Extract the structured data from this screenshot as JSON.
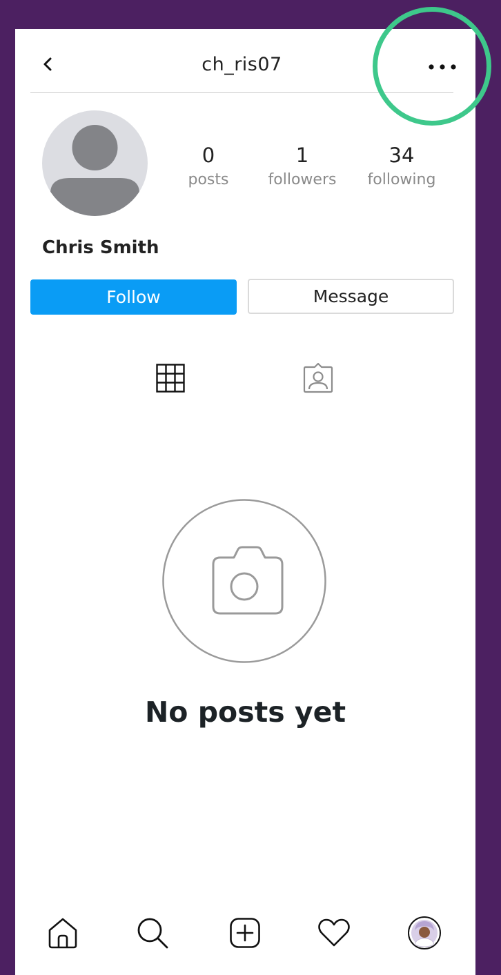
{
  "header": {
    "username": "ch_ris07"
  },
  "profile": {
    "full_name": "Chris Smith",
    "stats": [
      {
        "value": "0",
        "label": "posts"
      },
      {
        "value": "1",
        "label": "followers"
      },
      {
        "value": "34",
        "label": "following"
      }
    ]
  },
  "actions": {
    "follow_label": "Follow",
    "message_label": "Message"
  },
  "tabs": [
    {
      "icon": "grid-icon",
      "active": true
    },
    {
      "icon": "tagged-person-icon",
      "active": false
    }
  ],
  "empty_state": {
    "title": "No posts yet",
    "icon": "camera-icon"
  },
  "bottom_nav": [
    "home-icon",
    "search-icon",
    "add-post-icon",
    "heart-icon",
    "profile-avatar"
  ],
  "colors": {
    "background": "#4c2061",
    "accent": "#0a9cf5",
    "highlight": "#3ec88b"
  }
}
